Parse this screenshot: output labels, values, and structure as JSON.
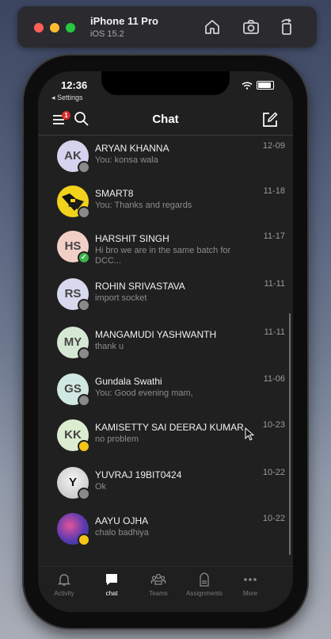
{
  "simulator": {
    "device": "iPhone 11 Pro",
    "os": "iOS 15.2",
    "buttons": [
      "home-icon",
      "screenshot-icon",
      "rotate-icon"
    ]
  },
  "status_bar": {
    "time": "12:36",
    "back_label": "◂ Settings"
  },
  "header": {
    "title": "Chat",
    "badge_count": "1"
  },
  "chats": [
    {
      "initials": "AK",
      "name": "ARYAN KHANNA",
      "preview": "You: konsa wala",
      "date": "12-09",
      "avatar_bg": "#d5d3ee",
      "presence": "gray"
    },
    {
      "initials": "",
      "name": "SMART8",
      "preview": "You: Thanks and regards",
      "date": "11-18",
      "avatar_bg": "#f2d21b",
      "presence": "gray"
    },
    {
      "initials": "HS",
      "name": "HARSHIT SINGH",
      "preview": "Hi bro we are in the same batch for DCC...",
      "date": "11-17",
      "avatar_bg": "#f2cfc6",
      "presence": "green"
    },
    {
      "initials": "RS",
      "name": "ROHIN SRIVASTAVA",
      "preview": "import socket",
      "date": "11-11",
      "avatar_bg": "#d8d8ef",
      "presence": "gray"
    },
    {
      "initials": "MY",
      "name": "MANGAMUDI YASHWANTH",
      "preview": "thank u",
      "date": "11-11",
      "avatar_bg": "#d5e8d4",
      "presence": "gray"
    },
    {
      "initials": "GS",
      "name": "Gundala Swathi",
      "preview": "You: Good evening mam,",
      "date": "11-06",
      "avatar_bg": "#cfe8e1",
      "presence": "gray"
    },
    {
      "initials": "KK",
      "name": "KAMISETTY SAI DEERAJ KUMAR",
      "preview": "no problem",
      "date": "10-23",
      "avatar_bg": "#dcecd0",
      "presence": "yellow"
    },
    {
      "initials": "Y",
      "name": "YUVRAJ 19BIT0424",
      "preview": "Ok",
      "date": "10-22",
      "avatar_bg": "#e6e6e6",
      "presence": "gray"
    },
    {
      "initials": "",
      "name": "AAYU OJHA",
      "preview": "chalo badhiya",
      "date": "10-22",
      "avatar_bg": "#6b3fa0",
      "presence": "yellow"
    }
  ],
  "tabs": [
    {
      "label": "Activity",
      "icon": "bell-icon",
      "active": false
    },
    {
      "label": "chat",
      "icon": "chat-icon",
      "active": true
    },
    {
      "label": "Teams",
      "icon": "teams-icon",
      "active": false
    },
    {
      "label": "Assignments",
      "icon": "assignments-icon",
      "active": false
    },
    {
      "label": "More",
      "icon": "more-icon",
      "active": false
    }
  ]
}
